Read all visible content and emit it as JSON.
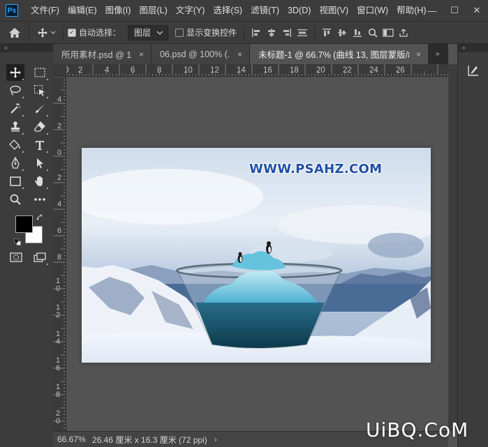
{
  "app": {
    "logo": "Ps"
  },
  "menu": [
    "文件(F)",
    "编辑(E)",
    "图像(I)",
    "图层(L)",
    "文字(Y)",
    "选择(S)",
    "滤镜(T)",
    "3D(D)",
    "视图(V)",
    "窗口(W)",
    "帮助(H)"
  ],
  "window_controls": {
    "minimize": "—",
    "maximize": "☐",
    "close": "✕"
  },
  "options": {
    "auto_select_label": "自动选择：",
    "auto_select_checked": true,
    "auto_select_target": "图层",
    "show_transform_label": "显示变换控件",
    "show_transform_checked": false
  },
  "tabs": [
    {
      "label": "所用素材.psd @ 1...",
      "close": "×",
      "active": false
    },
    {
      "label": "06.psd @ 100% (...",
      "close": "×",
      "active": false
    },
    {
      "label": "未标题-1 @ 66.7% (曲线 13, 图层蒙版/8) *",
      "close": "×",
      "active": true
    }
  ],
  "ruler_top": [
    "0",
    "2",
    "4",
    "6",
    "8",
    "10",
    "12",
    "14",
    "16",
    "18",
    "20",
    "22",
    "24",
    "26"
  ],
  "ruler_left": [
    "4",
    "2",
    "0",
    "2",
    "4",
    "6",
    "8",
    "10",
    "12",
    "14",
    "16",
    "18",
    "20"
  ],
  "status": {
    "zoom": "66.67%",
    "doc_info": "26.46 厘米 x 16.3 厘米 (72 ppi)",
    "arrow": "›"
  },
  "image": {
    "watermark": "WWW.PSAHZ.COM"
  },
  "site_watermark": "UiBQ.CoM",
  "colors": {
    "foreground": "#000000",
    "background": "#ffffff",
    "accent": "#31a8ff"
  }
}
